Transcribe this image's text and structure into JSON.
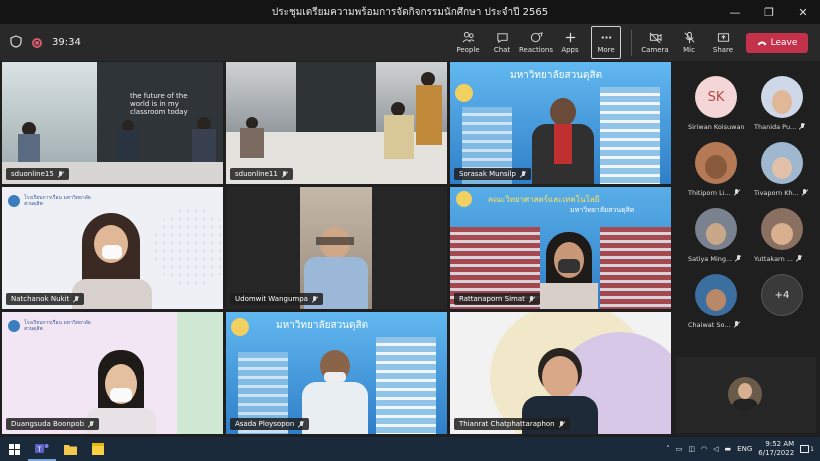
{
  "window": {
    "title": "ประชุมเตรียมความพร้อมการจัดกิจกรรมนักศึกษา ประจำปี 2565"
  },
  "toolbar": {
    "timer": "39:34",
    "buttons": [
      {
        "label": "People",
        "icon": "people-icon"
      },
      {
        "label": "Chat",
        "icon": "chat-icon"
      },
      {
        "label": "Reactions",
        "icon": "reactions-icon"
      },
      {
        "label": "Apps",
        "icon": "apps-icon"
      },
      {
        "label": "More",
        "icon": "more-icon"
      },
      {
        "label": "Camera",
        "icon": "camera-off-icon"
      },
      {
        "label": "Mic",
        "icon": "mic-off-icon"
      },
      {
        "label": "Share",
        "icon": "share-icon"
      }
    ],
    "leave_label": "Leave",
    "leave_color": "#c4314b"
  },
  "tiles": [
    {
      "name": "sduonline15",
      "bg": "#5b6770",
      "wall_text": "the future of the world is in my classroom today"
    },
    {
      "name": "sduonline11",
      "bg": "#6c7278"
    },
    {
      "name": "Sorasak Munsilp",
      "bg": "#3d8fd8",
      "banner": "มหาวิทยาลัยสวนดุสิต"
    },
    {
      "name": "Natchanok Nukit",
      "bg": "#eef0f6",
      "logo": "โรงเรียนการเรือน มหาวิทยาลัยสวนดุสิต"
    },
    {
      "name": "Udomwit Wangumpa",
      "bg": "#2b2b2b"
    },
    {
      "name": "Rattanaporn Simat",
      "bg": "#3a86cf",
      "banner": "คณะวิทยาศาสตร์และเทคโนโลยี",
      "banner2": "มหาวิทยาลัยสวนดุสิต"
    },
    {
      "name": "Duangsuda Boonpob",
      "bg": "#f3e6f4",
      "logo": "โรงเรียนการเรือน มหาวิทยาลัยสวนดุสิต"
    },
    {
      "name": "Asada Ploysopon",
      "bg": "#3d8fd8",
      "banner": "มหาวิทยาลัยสวนดุสิต"
    },
    {
      "name": "Thianrat Chatphattaraphon",
      "bg": "#f2f2f2"
    }
  ],
  "panel": {
    "people": [
      {
        "name": "Siriwan Koisuwan",
        "initials": "SK",
        "color": "#f5d6d6"
      },
      {
        "name": "Thanida Pu...",
        "color": "#cfd8e8"
      },
      {
        "name": "Thitiporn Li...",
        "color": "#b57a55"
      },
      {
        "name": "Tivaporn Kh...",
        "color": "#9fb8d0"
      },
      {
        "name": "Satiya Ming...",
        "color": "#7a8290"
      },
      {
        "name": "Yuttakarn ...",
        "color": "#8a7060"
      },
      {
        "name": "Chaiwat So...",
        "color": "#3a6fa0"
      },
      {
        "name": "+4",
        "initials": "+4"
      }
    ]
  },
  "taskbar": {
    "lang": "ENG",
    "time": "9:52 AM",
    "date": "6/17/2022",
    "notifications": "1"
  }
}
